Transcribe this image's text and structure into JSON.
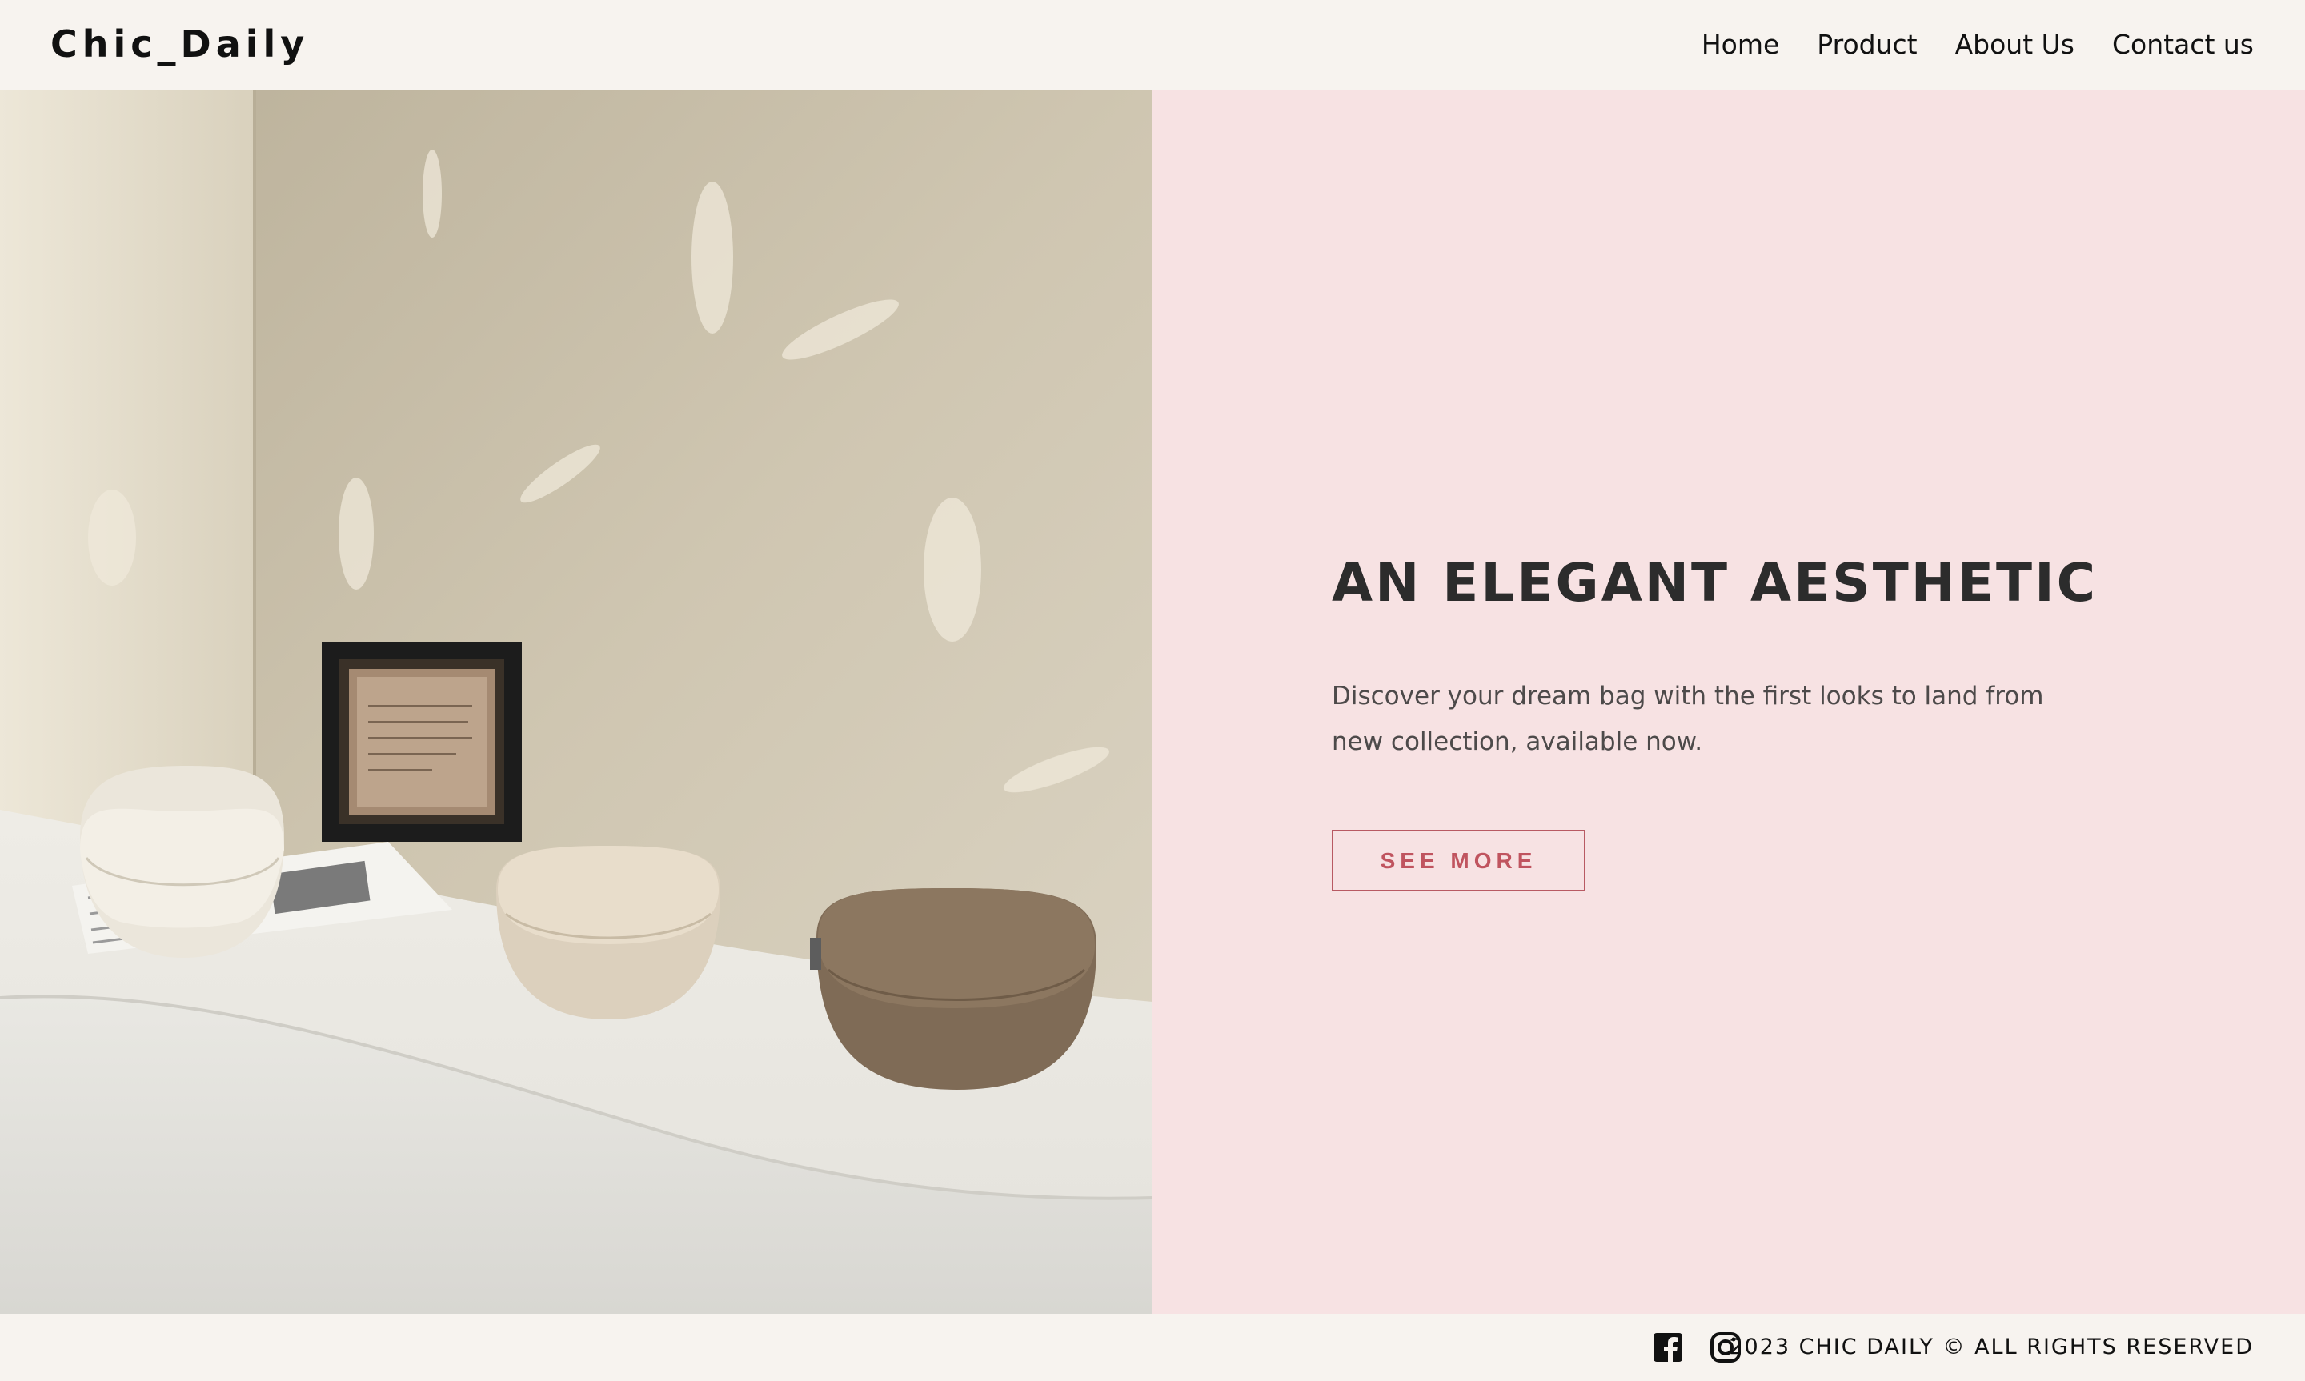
{
  "header": {
    "brand": "Chic_Daily",
    "nav": [
      {
        "label": "Home"
      },
      {
        "label": "Product"
      },
      {
        "label": "About Us"
      },
      {
        "label": "Contact us"
      }
    ]
  },
  "hero": {
    "image": "product-photo-three-saddle-bags-on-white-plaster-table",
    "headline": "AN ELEGANT AESTHETIC",
    "blurb": "Discover your dream bag with the first looks to land from new collection, available now.",
    "cta_label": "SEE MORE"
  },
  "footer": {
    "social_icons": [
      "facebook-icon",
      "instagram-icon"
    ],
    "copyright": "2023 CHIC DAILY © ALL RIGHTS RESERVED"
  },
  "colors": {
    "page_bg": "#f7f3ef",
    "panel_bg": "#f7e2e3",
    "accent": "#c0545f",
    "headline": "#2c2c2c"
  }
}
